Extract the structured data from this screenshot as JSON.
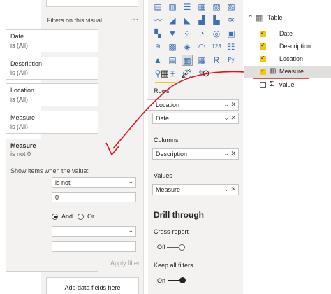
{
  "filters": {
    "header": "Filters on this visual",
    "menu_dots": "···",
    "cards": [
      {
        "title": "Date",
        "status": "is (All)"
      },
      {
        "title": "Description",
        "status": "is (All)"
      },
      {
        "title": "Location",
        "status": "is (All)"
      },
      {
        "title": "Measure",
        "status": "is (All)"
      }
    ],
    "expanded": {
      "title": "Measure",
      "status": "is not 0",
      "show_label": "Show items when the value:",
      "operator": "is not",
      "value": "0",
      "and_label": "And",
      "or_label": "Or",
      "second_operator": "",
      "second_value": "",
      "apply_label": "Apply filter"
    },
    "add_data": "Add data fields here"
  },
  "viz": {
    "icons": [
      [
        "bar-stacked-icon",
        "column-stacked-icon",
        "bar-clustered-icon",
        "column-clustered-icon",
        "bar-100-icon",
        "column-100-icon"
      ],
      [
        "line-icon",
        "area-icon",
        "stacked-area-icon",
        "line-column-icon",
        "line-clustered-icon",
        "ribbon-icon"
      ],
      [
        "waterfall-icon",
        "funnel-icon",
        "scatter-icon",
        "pie-icon",
        "donut-icon",
        "treemap-icon"
      ],
      [
        "map-icon",
        "filled-map-icon",
        "shape-map-icon",
        "gauge-icon",
        "card-icon",
        "multirow-card-icon"
      ],
      [
        "kpi-icon",
        "slicer-icon",
        "table-icon",
        "matrix-icon",
        "r-visual-icon",
        "python-visual-icon"
      ],
      [
        "key-influencers-icon",
        "decomposition-tree-icon",
        "qa-icon",
        "narrative-icon",
        "more-visuals-icon"
      ]
    ],
    "glyphs": [
      [
        "▤",
        "▥",
        "☰",
        "▦",
        "▧",
        "▨"
      ],
      [
        "〰",
        "◢",
        "◣",
        "▟",
        "▙",
        "≋"
      ],
      [
        "▚",
        "▼",
        "⁘",
        "◔",
        "◎",
        "▣"
      ],
      [
        "🜨",
        "▩",
        "◈",
        "◠",
        "123",
        "☷"
      ],
      [
        "▲",
        "▤",
        "▦",
        "▦",
        "R",
        "Py"
      ],
      [
        "⚲",
        "⊞",
        "◯",
        "✎",
        "···"
      ]
    ],
    "rows_label": "Rows",
    "rows": [
      "Location",
      "Date"
    ],
    "columns_label": "Columns",
    "columns": [
      "Description"
    ],
    "values_label": "Values",
    "values": [
      "Measure"
    ],
    "drill_title": "Drill through",
    "cross_report": "Cross-report",
    "cross_state": "Off",
    "keep_filters": "Keep all filters",
    "keep_state": "On"
  },
  "fields": {
    "table_name": "Table",
    "items": [
      {
        "name": "Date",
        "checked": true,
        "icon": ""
      },
      {
        "name": "Description",
        "checked": true,
        "icon": ""
      },
      {
        "name": "Location",
        "checked": true,
        "icon": ""
      },
      {
        "name": "Measure",
        "checked": true,
        "icon": "calculator"
      },
      {
        "name": "value",
        "checked": false,
        "icon": "sigma"
      }
    ]
  },
  "annotation_color": "#e0121b",
  "accent": "#f2c811"
}
